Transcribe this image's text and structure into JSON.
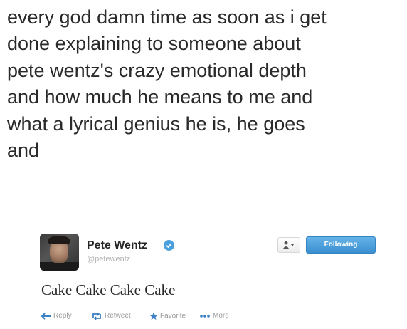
{
  "caption": {
    "lines": [
      "every god damn time as soon as i get",
      "done explaining to someone about",
      "pete wentz's crazy emotional depth",
      "and how much he means to me and",
      "what a lyrical genius he is, he goes",
      "and"
    ]
  },
  "tweet": {
    "author_name": "Pete Wentz",
    "author_handle": "@petewentz",
    "follow_label": "Following",
    "text": "Cake Cake Cake Cake",
    "actions": {
      "reply": "Reply",
      "retweet": "Retweet",
      "favorite": "Favorite",
      "more": "More"
    }
  },
  "colors": {
    "follow_button": "#4a9fdd",
    "verified_badge": "#4a9fdd",
    "action_reply": "#3b7fc4",
    "action_retweet": "#3b7fc4",
    "action_favorite": "#3b7fc4"
  },
  "icons": {
    "verified": "verified-check-icon",
    "user_menu": "person-icon",
    "reply": "reply-arrow-icon",
    "retweet": "retweet-icon",
    "favorite": "star-icon",
    "more": "more-dots-icon"
  }
}
